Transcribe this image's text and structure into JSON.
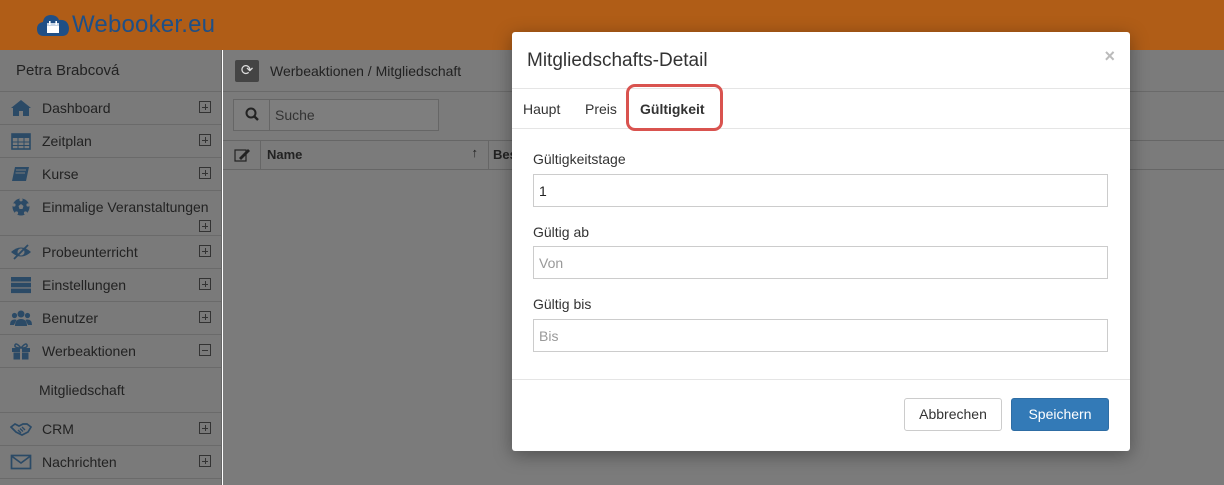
{
  "app": {
    "logo_text": "Webooker.eu",
    "brand_color": "#b05d17",
    "logo_color": "#1f4f86"
  },
  "sidebar": {
    "user_name": "Petra Brabcová",
    "items": [
      {
        "label": "Dashboard",
        "icon": "home-icon",
        "expanded": false
      },
      {
        "label": "Zeitplan",
        "icon": "calendar-icon",
        "expanded": false
      },
      {
        "label": "Kurse",
        "icon": "book-icon",
        "expanded": false
      },
      {
        "label": "Einmalige Veranstaltungen",
        "icon": "soccer-ball-icon",
        "expanded": false
      },
      {
        "label": "Probeunterricht",
        "icon": "eye-icon",
        "expanded": false
      },
      {
        "label": "Einstellungen",
        "icon": "server-icon",
        "expanded": false
      },
      {
        "label": "Benutzer",
        "icon": "users-icon",
        "expanded": false
      },
      {
        "label": "Werbeaktionen",
        "icon": "gift-icon",
        "expanded": true
      },
      {
        "label": "CRM",
        "icon": "handshake-icon",
        "expanded": false
      },
      {
        "label": "Nachrichten",
        "icon": "envelope-icon",
        "expanded": false
      }
    ],
    "subitem": "Mitgliedschaft"
  },
  "main": {
    "breadcrumb": "Werbeaktionen / Mitgliedschaft",
    "search_placeholder": "Suche",
    "columns": [
      "Name",
      "Bes"
    ]
  },
  "modal": {
    "title": "Mitgliedschafts-Detail",
    "close": "×",
    "tabs": [
      "Haupt",
      "Preis",
      "Gültigkeit"
    ],
    "active_tab": "Gültigkeit",
    "fields": {
      "days_label": "Gültigkeitstage",
      "days_value": "1",
      "from_label": "Gültig ab",
      "from_placeholder": "Von",
      "to_label": "Gültig bis",
      "to_placeholder": "Bis"
    },
    "cancel_label": "Abbrechen",
    "save_label": "Speichern",
    "highlight_color": "#d9534f",
    "primary_color": "#337ab7"
  }
}
